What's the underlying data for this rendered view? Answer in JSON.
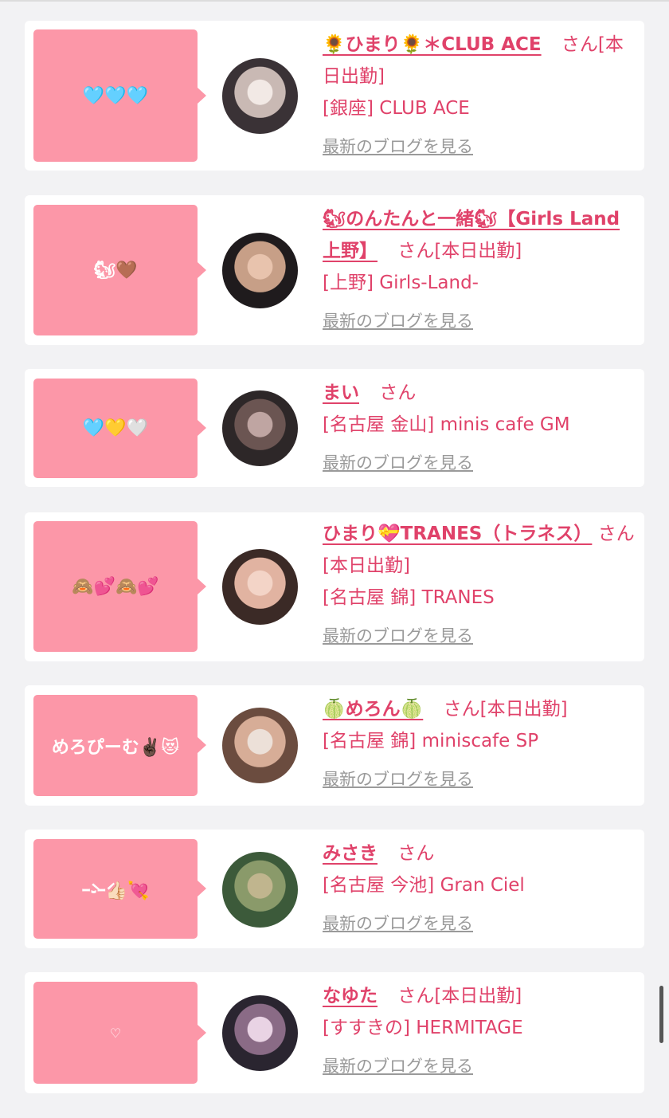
{
  "cards": [
    {
      "bubble": "🩵🩵🩵",
      "name": "🌻ひまり🌻＊CLUB ACE",
      "suffix": "さん[本日出勤]",
      "shop": "[銀座] CLUB ACE",
      "blog_link": "最新のブログを見る",
      "avatar_colors": [
        "#3a3236",
        "#c9b9b4",
        "#f2e9e5"
      ]
    },
    {
      "bubble": "🐿🤎",
      "name": "🐿のんたんと一緒🐿【Girls Land 上野】",
      "suffix": "さん[本日出勤]",
      "shop": "[上野] Girls-Land-",
      "blog_link": "最新のブログを見る",
      "avatar_colors": [
        "#1f1b1d",
        "#c79f87",
        "#e8c3ad"
      ]
    },
    {
      "bubble": "🩵💛🤍",
      "name": "まい",
      "suffix": "さん",
      "shop": "[名古屋 金山] minis cafe GM",
      "blog_link": "最新のブログを見る",
      "avatar_colors": [
        "#2d2728",
        "#6b5552",
        "#bfa5a2"
      ]
    },
    {
      "bubble": "🙈💕🙈💕",
      "name": "ひまり💝TRANES（トラネス）",
      "suffix": "さん[本日出勤]",
      "shop": "[名古屋 錦] TRANES",
      "blog_link": "最新のブログを見る",
      "avatar_colors": [
        "#3b2a26",
        "#e1b3a1",
        "#f3d4c7"
      ]
    },
    {
      "bubble": "めろぴーむ✌🏿😻",
      "name": "🍈めろん🍈",
      "suffix": "さん[本日出勤]",
      "shop": "[名古屋 錦] miniscafe SP",
      "blog_link": "最新のブログを見る",
      "avatar_colors": [
        "#6b4c3f",
        "#d7ad97",
        "#ece0d8"
      ]
    },
    {
      "bubble": "ｰ̀֊ｰ́👍🏻💘",
      "name": "みさき",
      "suffix": "さん",
      "shop": "[名古屋 今池] Gran Ciel",
      "blog_link": "最新のブログを見る",
      "avatar_colors": [
        "#3c5a3a",
        "#8a9a6a",
        "#c0b58e"
      ]
    },
    {
      "bubble": "♡",
      "name": "なゆた",
      "suffix": "さん[本日出勤]",
      "shop": "[すすきの] HERMITAGE",
      "blog_link": "最新のブログを見る",
      "avatar_colors": [
        "#2a2530",
        "#8a6b86",
        "#e9d3e4"
      ]
    }
  ]
}
